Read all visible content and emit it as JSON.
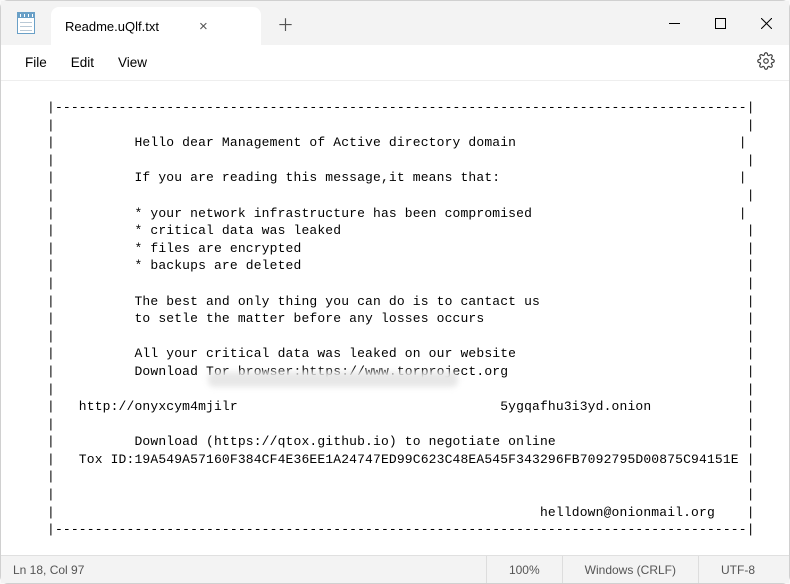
{
  "window": {
    "tab_title": "Readme.uQlf.txt",
    "close_icon": "×",
    "newtab_icon": "＋",
    "min_icon": "—"
  },
  "menu": {
    "file": "File",
    "edit": "Edit",
    "view": "View"
  },
  "doc": {
    "body": "|---------------------------------------------------------------------------------------|\n|                                                                                       |\n|          Hello dear Management of Active directory domain                            |\n|                                                                                       |\n|          If you are reading this message,it means that:                              |\n|                                                                                       |\n|          * your network infrastructure has been compromised                          |\n|          * critical data was leaked                                                   |\n|          * files are encrypted                                                        |\n|          * backups are deleted                                                        |\n|                                                                                       |\n|          The best and only thing you can do is to cantact us                          |\n|          to setle the matter before any losses occurs                                 |\n|                                                                                       |\n|          All your critical data was leaked on our website                             |\n|          Download Tor browser:https://www.torproject.org                              |\n|                                                                                       |\n|   http://onyxcym4mjilr                                 5ygqafhu3i3yd.onion            |\n|                                                                                       |\n|          Download (https://qtox.github.io) to negotiate online                        |\n|   Tox ID:19A549A57160F384CF4E36EE1A24747ED99C623C48EA545F343296FB7092795D00875C94151E |\n|                                                                                       |\n|                                                                                       |\n|                                                             helldown@onionmail.org    |\n|---------------------------------------------------------------------------------------|"
  },
  "status": {
    "cursor": "Ln 18, Col 97",
    "zoom": "100%",
    "line_ending": "Windows (CRLF)",
    "encoding": "UTF-8"
  }
}
